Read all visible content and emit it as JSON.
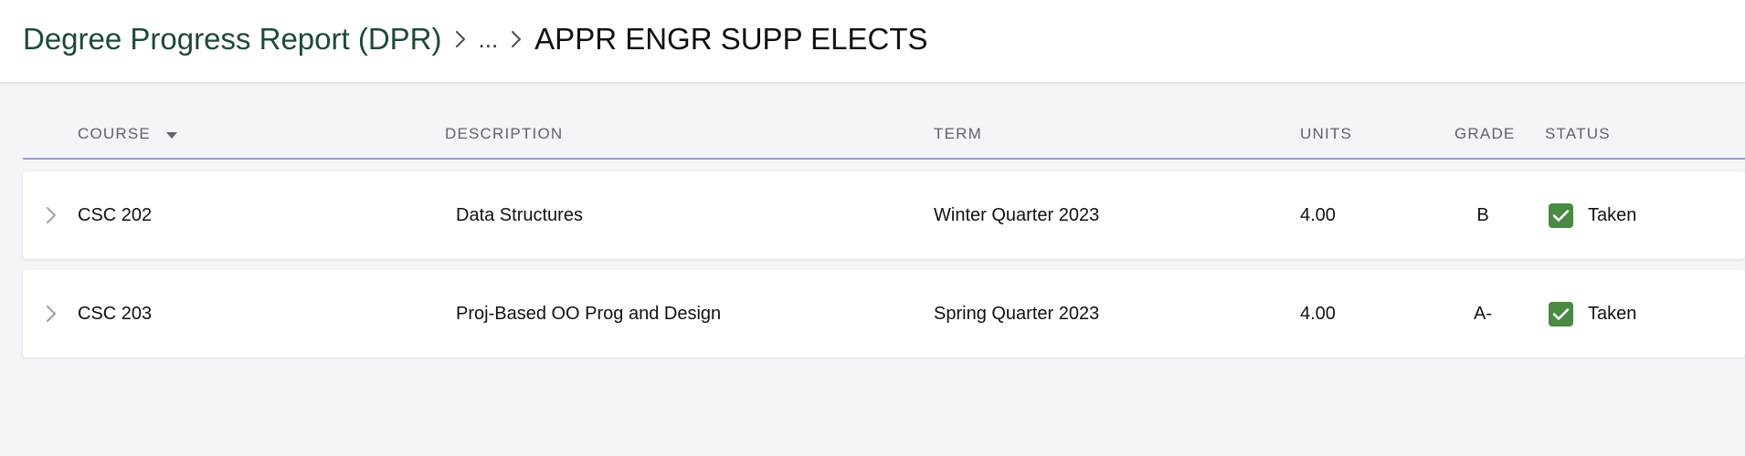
{
  "breadcrumb": {
    "root": "Degree Progress Report (DPR)",
    "ellipsis": "...",
    "current": "APPR ENGR SUPP ELECTS"
  },
  "table": {
    "columns": {
      "course": "COURSE",
      "description": "DESCRIPTION",
      "term": "TERM",
      "units": "UNITS",
      "grade": "GRADE",
      "status": "STATUS"
    },
    "rows": [
      {
        "course": "CSC 202",
        "description": "Data Structures",
        "term": "Winter Quarter 2023",
        "units": "4.00",
        "grade": "B",
        "status": "Taken"
      },
      {
        "course": "CSC 203",
        "description": "Proj-Based OO Prog and Design",
        "term": "Spring Quarter 2023",
        "units": "4.00",
        "grade": "A-",
        "status": "Taken"
      }
    ]
  },
  "colors": {
    "breadcrumb_link": "#1f4a33",
    "status_taken": "#4a8a44",
    "header_rule": "#9aa0c2"
  },
  "icons": {
    "breadcrumb_separator": "chevron-right-icon",
    "sort": "caret-down-icon",
    "row_expand": "chevron-right-icon",
    "status": "checkbox-checked-icon"
  }
}
